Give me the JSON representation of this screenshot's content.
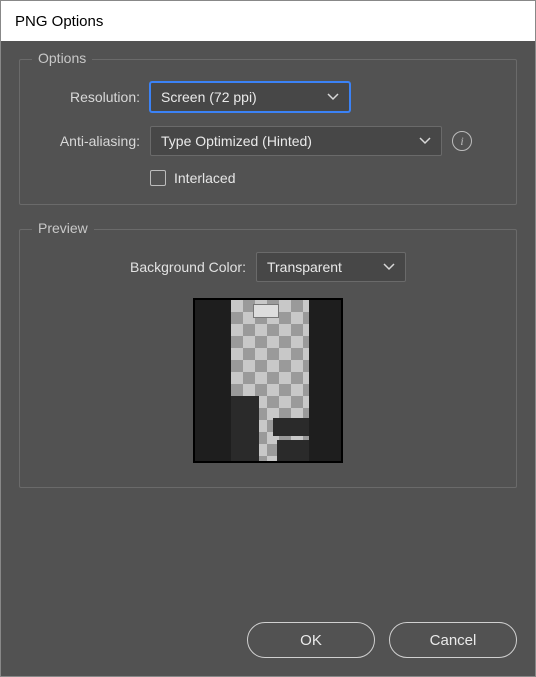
{
  "window": {
    "title": "PNG Options"
  },
  "options": {
    "group_title": "Options",
    "resolution_label": "Resolution:",
    "resolution_value": "Screen (72 ppi)",
    "antialias_label": "Anti-aliasing:",
    "antialias_value": "Type Optimized (Hinted)",
    "interlaced_label": "Interlaced",
    "interlaced_checked": false
  },
  "preview": {
    "group_title": "Preview",
    "bgcolor_label": "Background Color:",
    "bgcolor_value": "Transparent"
  },
  "buttons": {
    "ok": "OK",
    "cancel": "Cancel"
  }
}
